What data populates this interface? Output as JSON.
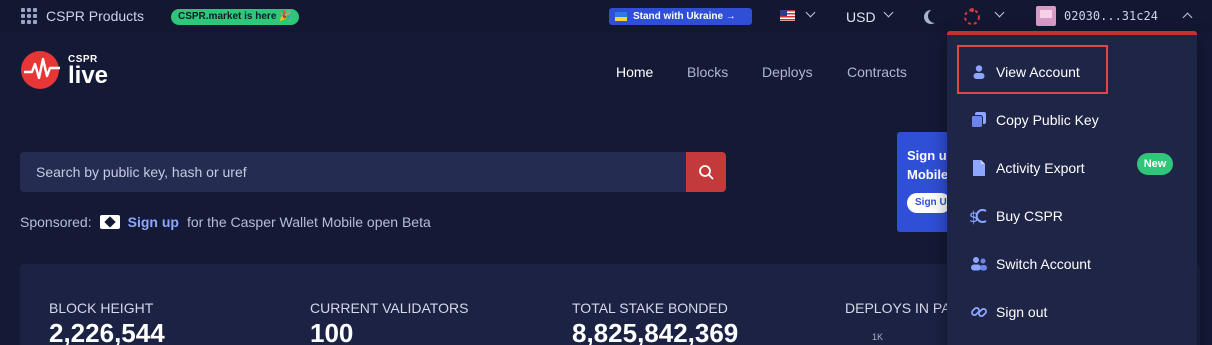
{
  "topbar": {
    "products_label": "CSPR Products",
    "market_badge": "CSPR.market is here 🎉",
    "ukraine_label": "Stand with Ukraine →",
    "currency": "USD",
    "account_key": "02030...31c24"
  },
  "brand": {
    "small": "CSPR",
    "large": "live"
  },
  "nav": {
    "items": [
      "Home",
      "Blocks",
      "Deploys",
      "Contracts"
    ]
  },
  "search": {
    "placeholder": "Search by public key, hash or uref"
  },
  "sponsored": {
    "label": "Sponsored:",
    "link": "Sign up",
    "text": "for the Casper Wallet Mobile open Beta"
  },
  "promo": {
    "line1": "Sign u",
    "line2": "Mobile",
    "button": "Sign U"
  },
  "stats": [
    {
      "label": "BLOCK HEIGHT",
      "value": "2,226,544"
    },
    {
      "label": "CURRENT VALIDATORS",
      "value": "100"
    },
    {
      "label": "TOTAL STAKE BONDED",
      "value": "8,825,842,369"
    },
    {
      "label": "DEPLOYS IN PAS",
      "value": ""
    }
  ],
  "chart_tick": "1K",
  "dropdown": {
    "items": [
      {
        "label": "View Account",
        "icon": "user-icon"
      },
      {
        "label": "Copy Public Key",
        "icon": "copy-icon"
      },
      {
        "label": "Activity Export",
        "icon": "export-icon",
        "badge": "New"
      },
      {
        "label": "Buy CSPR",
        "icon": "buy-cspr-icon"
      },
      {
        "label": "Switch Account",
        "icon": "switch-account-icon"
      },
      {
        "label": "Sign out",
        "icon": "sign-out-icon"
      }
    ]
  },
  "colors": {
    "background": "#141a36",
    "accent_red": "#c53030",
    "badge_green": "#2fc67a",
    "ukraine_blue": "#2f4fd6",
    "link_blue": "#8da6ff"
  }
}
